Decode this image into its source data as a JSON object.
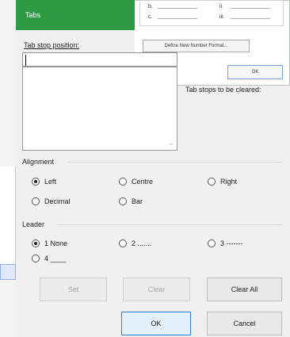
{
  "background_dialog": {
    "list_items": [
      "b.",
      "c.",
      "ii.",
      "iii."
    ],
    "define_button": "Define New Number Format...",
    "ok_button": "OK"
  },
  "dialog": {
    "title": "Tabs",
    "tab_stop_label": "Tab stop position:",
    "tab_stop_value": "",
    "to_clear_label": "Tab stops to be cleared:",
    "alignment": {
      "label": "Alignment",
      "options": [
        "Left",
        "Centre",
        "Right",
        "Decimal",
        "Bar"
      ],
      "selected": "Left"
    },
    "leader": {
      "label": "Leader",
      "options": [
        "1 None",
        "2 .......",
        "3 -------",
        "4 ____"
      ],
      "selected": "1 None"
    },
    "buttons": {
      "set": "Set",
      "clear": "Clear",
      "clear_all": "Clear All",
      "ok": "OK",
      "cancel": "Cancel"
    }
  },
  "colors": {
    "titlebar": "#2e9b44",
    "default_button_border": "#3b7ad6"
  }
}
